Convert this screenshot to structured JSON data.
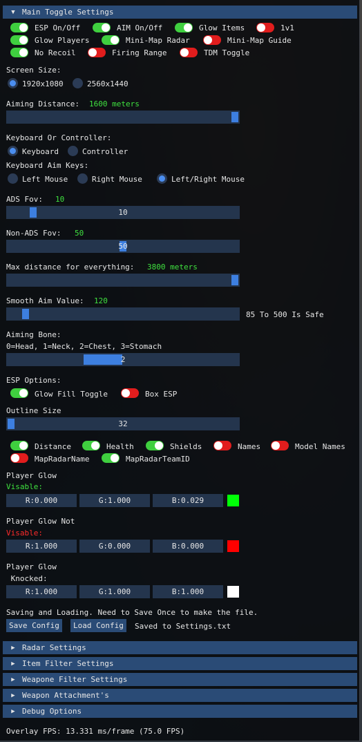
{
  "main_header": "Main Toggle Settings",
  "toggles": [
    {
      "label": "ESP On/Off",
      "on": true
    },
    {
      "label": "AIM On/Off",
      "on": true
    },
    {
      "label": "Glow Items",
      "on": true
    },
    {
      "label": "1v1",
      "on": false
    },
    {
      "label": "Glow Players",
      "on": true
    },
    {
      "label": "Mini-Map Radar",
      "on": true
    },
    {
      "label": "Mini-Map Guide",
      "on": false
    },
    {
      "label": "No Recoil",
      "on": true
    },
    {
      "label": "Firing Range",
      "on": false
    },
    {
      "label": "TDM Toggle",
      "on": false
    }
  ],
  "screen_size": {
    "label": "Screen Size:",
    "options": [
      "1920x1080",
      "2560x1440"
    ],
    "selected": 0
  },
  "aiming_distance": {
    "label": "Aiming Distance:",
    "value_text": "1600 meters",
    "fraction": 1.0
  },
  "input_mode": {
    "label": "Keyboard Or Controller:",
    "options": [
      "Keyboard",
      "Controller"
    ],
    "selected": 0
  },
  "aim_keys": {
    "label": "Keyboard Aim Keys:",
    "options": [
      "Left Mouse",
      "Right Mouse",
      "Left/Right Mouse"
    ],
    "selected": 2
  },
  "ads_fov": {
    "label": "ADS Fov:",
    "value_text": "10",
    "slider_value": "10",
    "fraction": 0.1
  },
  "non_ads_fov": {
    "label": "Non-ADS Fov:",
    "value_text": "50",
    "slider_value": "50",
    "fraction": 0.5
  },
  "max_distance": {
    "label": "Max distance for everything:",
    "value_text": "3800 meters",
    "fraction": 1.0
  },
  "smooth_aim": {
    "label": "Smooth Aim Value:",
    "value_text": "120",
    "fraction": 0.07,
    "hint": "85 To 500 Is Safe"
  },
  "aiming_bone": {
    "label": "Aiming Bone:",
    "legend": "0=Head, 1=Neck, 2=Chest, 3=Stomach",
    "slider_value": "2",
    "fraction": 0.667
  },
  "esp_options": {
    "label": "ESP Options:",
    "toggles": [
      {
        "label": "Glow Fill Toggle",
        "on": true
      },
      {
        "label": "Box ESP",
        "on": false
      }
    ]
  },
  "outline_size": {
    "label": "Outline Size",
    "slider_value": "32",
    "fraction": 0.0
  },
  "esp_toggles": [
    {
      "label": "Distance",
      "on": true
    },
    {
      "label": "Health",
      "on": true
    },
    {
      "label": "Shields",
      "on": true
    },
    {
      "label": "Names",
      "on": false
    },
    {
      "label": "Model Names",
      "on": false
    },
    {
      "label": "MapRadarName",
      "on": false
    },
    {
      "label": "MapRadarTeamID",
      "on": true
    }
  ],
  "glow_visible": {
    "title": "Player Glow",
    "sub": "Visable:",
    "r": "R:0.000",
    "g": "G:1.000",
    "b": "B:0.029",
    "color": "#00ff07"
  },
  "glow_not_visible": {
    "title": "Player Glow Not",
    "sub": "Visable:",
    "r": "R:1.000",
    "g": "G:0.000",
    "b": "B:0.000",
    "color": "#ff0000"
  },
  "glow_knocked": {
    "title": "Player Glow",
    "sub": " Knocked:",
    "r": "R:1.000",
    "g": "G:1.000",
    "b": "B:1.000",
    "color": "#ffffff"
  },
  "save_section": {
    "info": "Saving and Loading. Need to Save Once to make the file.",
    "save_label": "Save Config",
    "load_label": "Load Config",
    "status": "Saved to Settings.txt"
  },
  "collapsed_sections": [
    "Radar Settings",
    "Item Filter Settings",
    "Weapone Filter Settings",
    "Weapon Attachment's",
    "Debug Options"
  ],
  "fps_text": "Overlay FPS: 13.331 ms/frame (75.0 FPS)",
  "colors": {
    "accent": "#2a4b76",
    "toggle_on": "#3fcf3f",
    "toggle_off": "#e11d1d",
    "value_green": "#3fe23f",
    "value_red": "#ff2a2a"
  }
}
